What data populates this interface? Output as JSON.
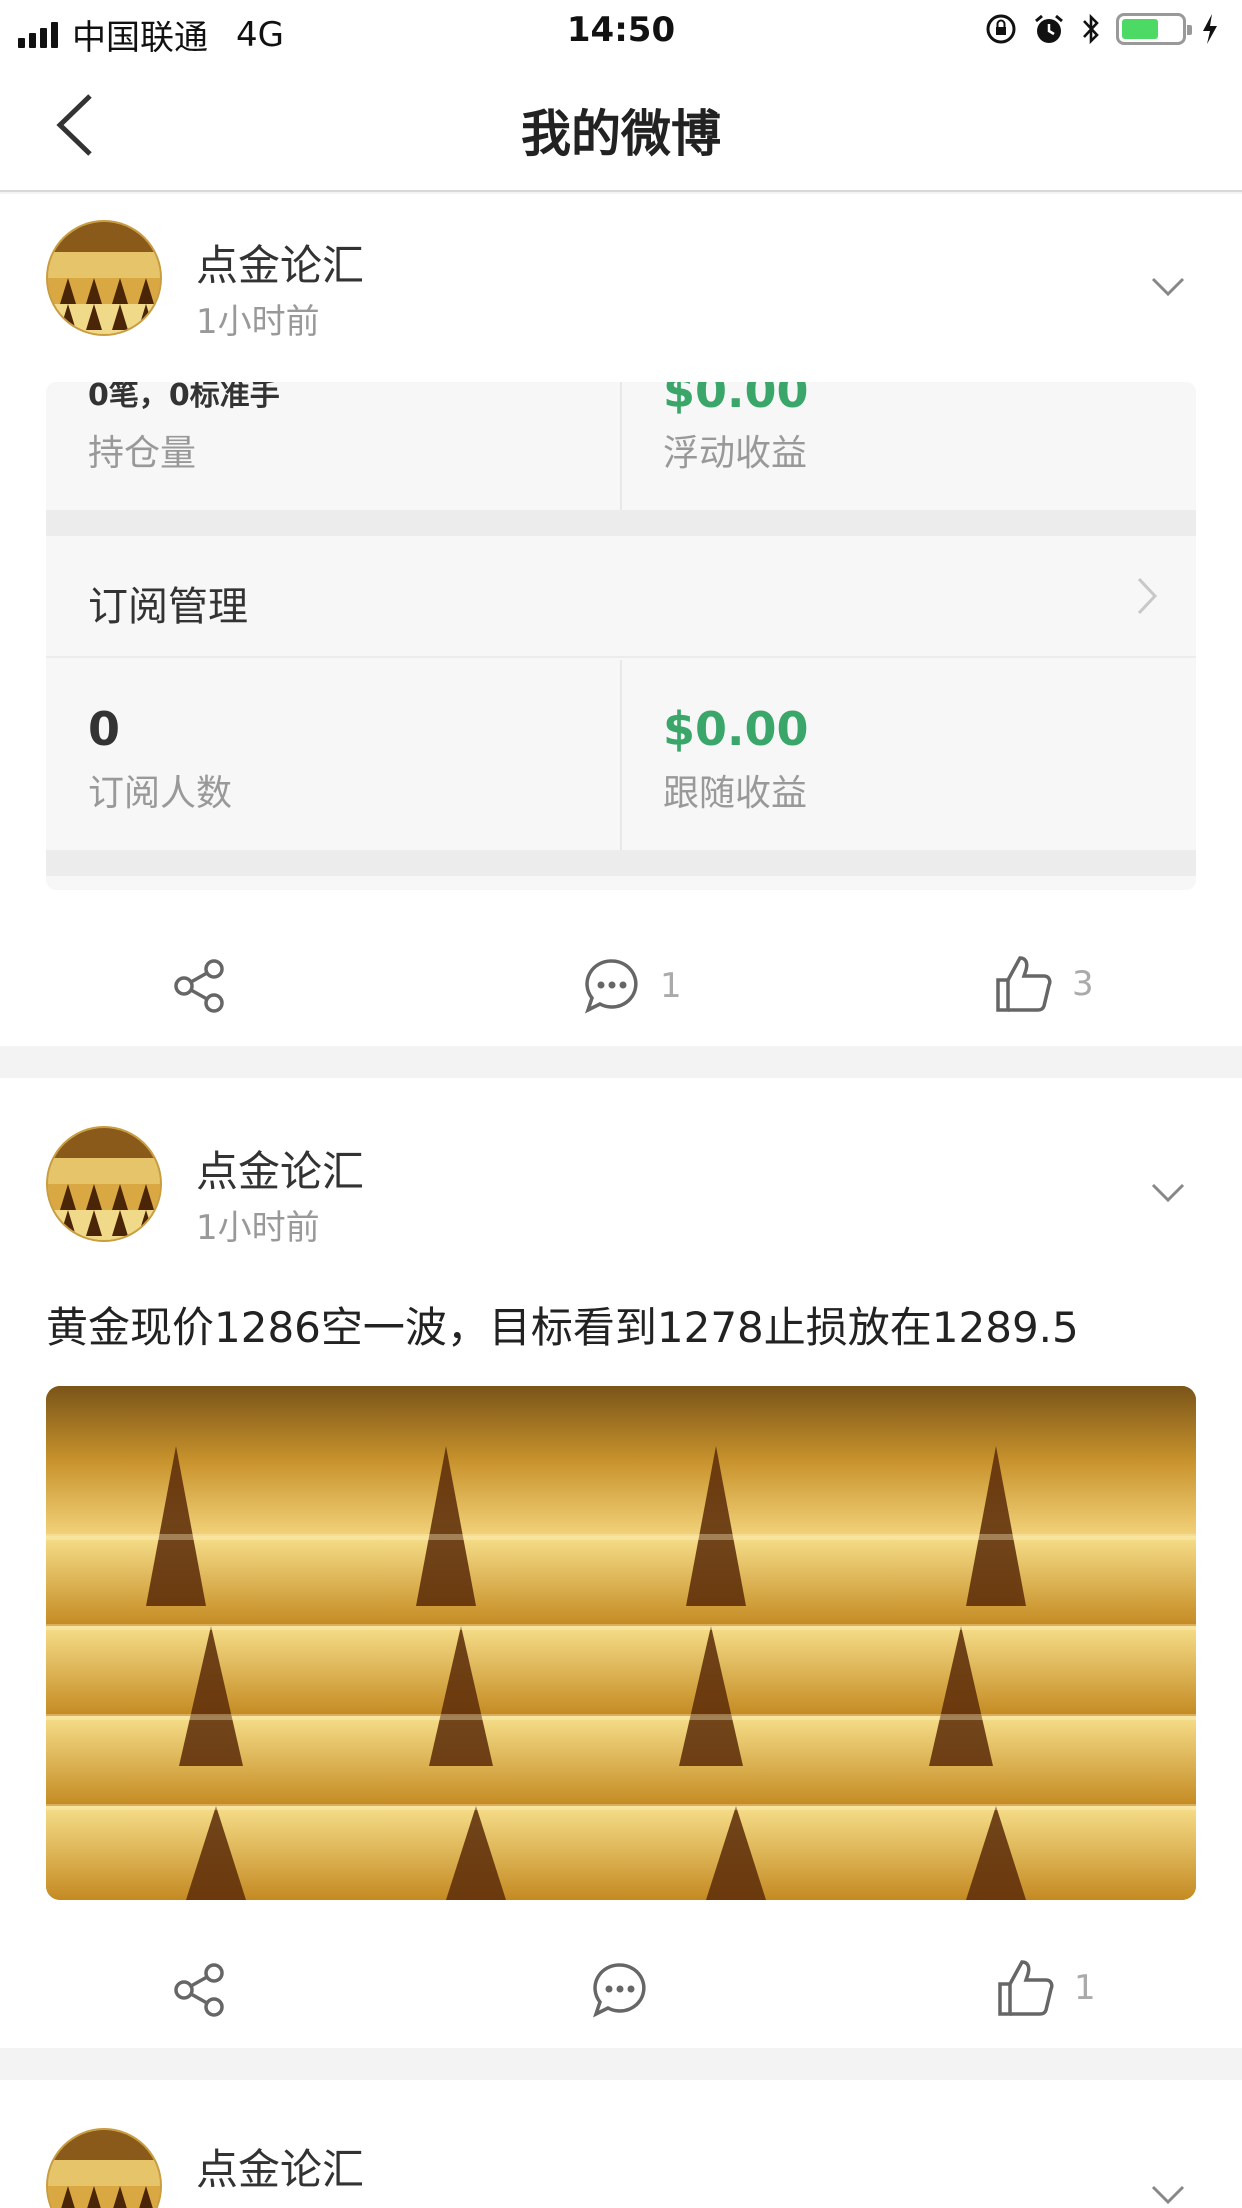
{
  "status_bar": {
    "carrier": "中国联通",
    "network": "4G",
    "time": "14:50"
  },
  "nav": {
    "title": "我的微博",
    "back_icon": "chevron-left-icon"
  },
  "colors": {
    "accent_green": "#3aa66a",
    "gold": "#c99c3e",
    "muted": "#999999"
  },
  "posts": [
    {
      "author": "点金论汇",
      "time": "1小时前",
      "stats_top": {
        "left_value": "0笔，0标准手",
        "left_label": "持仓量",
        "right_value": "$0.00",
        "right_label": "浮动收益"
      },
      "subscription": {
        "label": "订阅管理",
        "subscribers_value": "0",
        "subscribers_label": "订阅人数",
        "follow_value": "$0.00",
        "follow_label": "跟随收益"
      },
      "actions": {
        "comment_count": "1",
        "like_count": "3"
      }
    },
    {
      "author": "点金论汇",
      "time": "1小时前",
      "text": "黄金现价1286空一波，目标看到1278止损放在1289.5",
      "actions": {
        "comment_count": "",
        "like_count": "1"
      }
    },
    {
      "author": "点金论汇"
    }
  ]
}
